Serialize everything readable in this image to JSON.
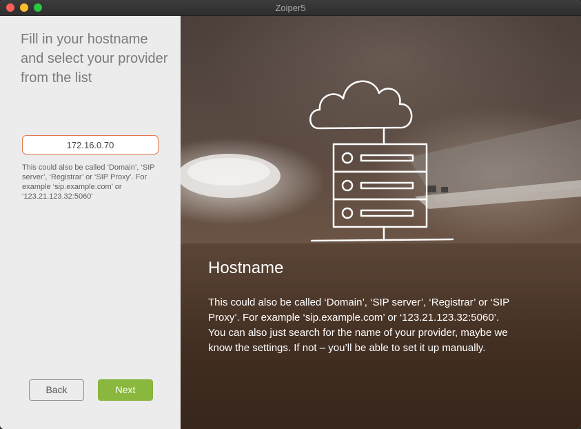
{
  "window": {
    "title": "Zoiper5"
  },
  "left_panel": {
    "heading": "Fill in your hostname and select your provider from the list",
    "hostname_value": "172.16.0.70",
    "hint": "This could also be called ‘Domain’, ‘SIP server’, ‘Registrar’ or ‘SIP Proxy’. For example ‘sip.example.com’ or ‘123.21.123.32:5060’",
    "back_label": "Back",
    "next_label": "Next"
  },
  "right_panel": {
    "title": "Hostname",
    "line1": " This could also be called ‘Domain’, ‘SIP server’, ‘Registrar’ or ‘SIP Proxy’. For example ‘sip.example.com’ or ‘123.21.123.32:5060’.",
    "line2": "You can also just search for the name of your provider, maybe we know the settings. If not – you’ll be able to set it up manually."
  },
  "colors": {
    "accent_input_border": "#e4784a",
    "next_button": "#8ab83e"
  },
  "icons": [
    "cloud-server-icon"
  ]
}
